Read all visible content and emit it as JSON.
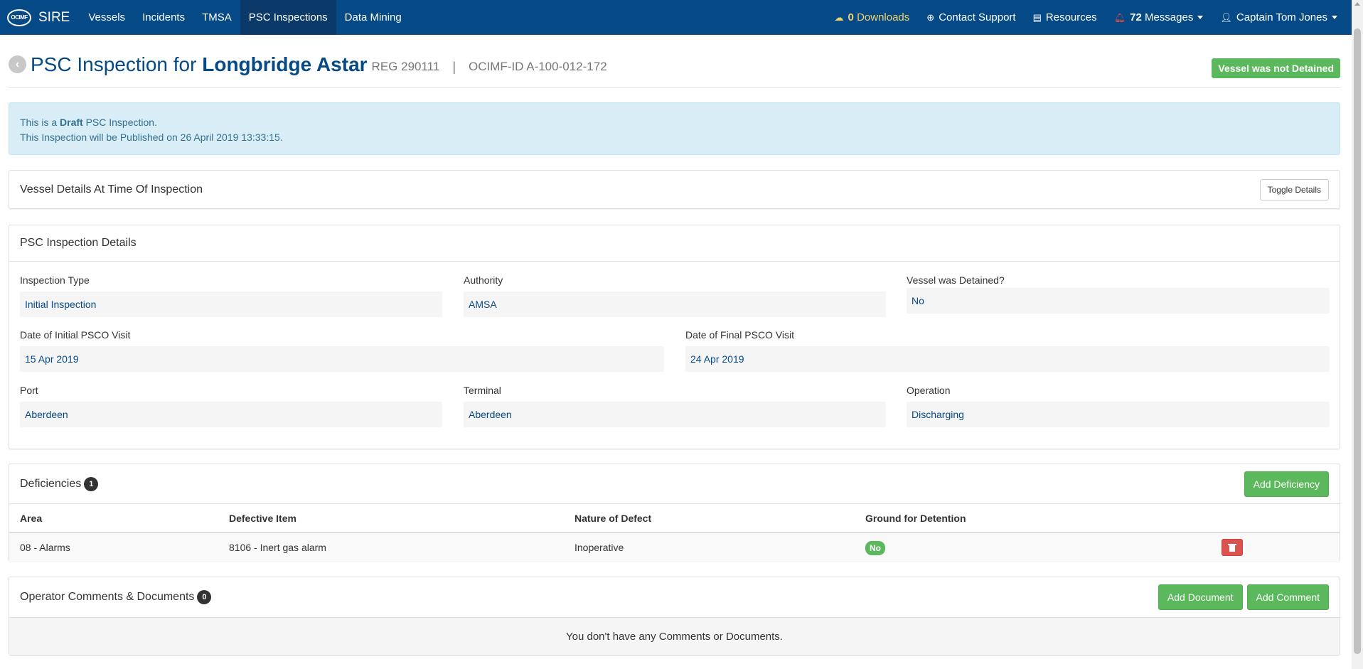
{
  "navbar": {
    "brand_logo": "OCIMF",
    "brand_name": "SIRE",
    "left_items": [
      "Vessels",
      "Incidents",
      "TMSA",
      "PSC Inspections",
      "Data Mining"
    ],
    "downloads_count": "0",
    "downloads_label": "Downloads",
    "contact_support": "Contact Support",
    "resources": "Resources",
    "messages_count": "72",
    "messages_label": "Messages",
    "user_name": "Captain Tom Jones"
  },
  "header": {
    "title_prefix": "PSC Inspection for",
    "vessel_name": "Longbridge Astar",
    "reg": "REG 290111",
    "separator": "|",
    "ocimf_id": "OCIMF-ID  A-100-012-172",
    "detained_label": "Vessel was not Detained"
  },
  "alert": {
    "line1_pre": "This is a",
    "line1_bold": "Draft",
    "line1_post": "PSC Inspection.",
    "line2": "This Inspection will be Published on 26 April 2019 13:33:15."
  },
  "vessel_details": {
    "title": "Vessel Details At Time Of Inspection",
    "toggle_button": "Toggle Details"
  },
  "inspection_details": {
    "title": "PSC Inspection Details",
    "inspection_type_label": "Inspection Type",
    "inspection_type_value": "Initial Inspection",
    "authority_label": "Authority",
    "authority_value": "AMSA",
    "detained_label": "Vessel was Detained?",
    "detained_value": "No",
    "initial_visit_label": "Date of Initial PSCO Visit",
    "initial_visit_value": "15 Apr 2019",
    "final_visit_label": "Date of Final PSCO Visit",
    "final_visit_value": "24 Apr 2019",
    "port_label": "Port",
    "port_value": "Aberdeen",
    "terminal_label": "Terminal",
    "terminal_value": "Aberdeen",
    "operation_label": "Operation",
    "operation_value": "Discharging"
  },
  "deficiencies": {
    "title": "Deficiencies",
    "count": "1",
    "add_button": "Add Deficiency",
    "columns": [
      "Area",
      "Defective Item",
      "Nature of Defect",
      "Ground for Detention"
    ],
    "rows": [
      {
        "area": "08 - Alarms",
        "item": "8106 - Inert gas alarm",
        "nature": "Inoperative",
        "ground": "No"
      }
    ]
  },
  "comments": {
    "title": "Operator Comments & Documents",
    "count": "0",
    "add_document": "Add Document",
    "add_comment": "Add Comment",
    "empty_text": "You don't have any Comments or Documents."
  },
  "colors": {
    "navbar": "#054a86",
    "success": "#5cb85c",
    "danger": "#d9534f",
    "info_bg": "#d9edf7"
  }
}
